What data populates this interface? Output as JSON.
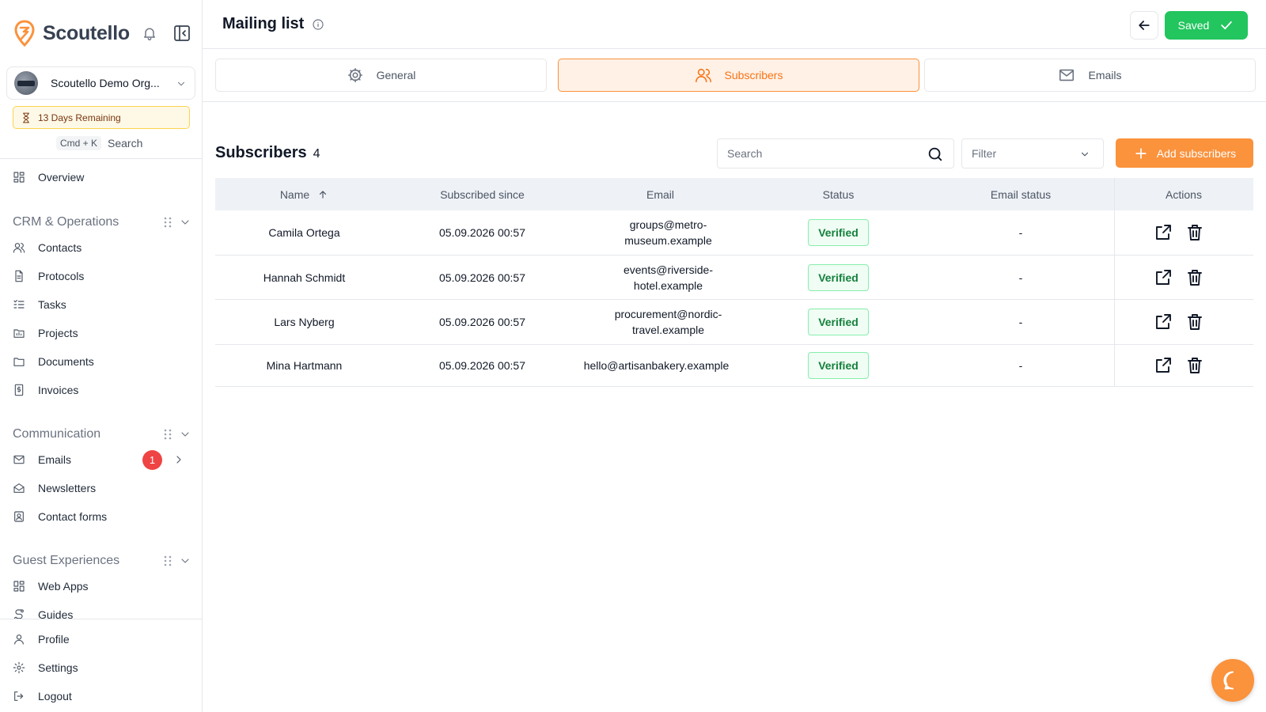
{
  "app": {
    "brand": "Scoutello",
    "accent_color": "#fb923c",
    "success_color": "#22c55e"
  },
  "sidebar": {
    "org_name": "Scoutello Demo Org...",
    "trial_text": "13 Days Remaining",
    "shortcut_key": "Cmd + K",
    "shortcut_label": "Search",
    "overview": "Overview",
    "sections": [
      {
        "title": "CRM & Operations",
        "items": [
          {
            "label": "Contacts",
            "icon": "contacts-icon"
          },
          {
            "label": "Protocols",
            "icon": "protocol-icon"
          },
          {
            "label": "Tasks",
            "icon": "tasks-icon"
          },
          {
            "label": "Projects",
            "icon": "projects-icon"
          },
          {
            "label": "Documents",
            "icon": "documents-icon"
          },
          {
            "label": "Invoices",
            "icon": "invoice-icon"
          }
        ]
      },
      {
        "title": "Communication",
        "items": [
          {
            "label": "Emails",
            "icon": "mail-icon",
            "badge": "1"
          },
          {
            "label": "Newsletters",
            "icon": "newsletter-icon"
          },
          {
            "label": "Contact forms",
            "icon": "contact-form-icon"
          }
        ]
      },
      {
        "title": "Guest Experiences",
        "items": [
          {
            "label": "Web Apps",
            "icon": "web-apps-icon"
          },
          {
            "label": "Guides",
            "icon": "guides-icon"
          }
        ]
      }
    ],
    "bottom": [
      {
        "label": "Profile",
        "icon": "profile-icon"
      },
      {
        "label": "Settings",
        "icon": "settings-icon"
      },
      {
        "label": "Logout",
        "icon": "logout-icon"
      }
    ]
  },
  "header": {
    "title": "Mailing list",
    "saved_label": "Saved"
  },
  "tabs": [
    {
      "label": "General",
      "icon": "gear-icon",
      "active": false
    },
    {
      "label": "Subscribers",
      "icon": "users-icon",
      "active": true
    },
    {
      "label": "Emails",
      "icon": "mail-icon",
      "active": false
    }
  ],
  "subscribers": {
    "title": "Subscribers",
    "count": "4",
    "search_placeholder": "Search",
    "filter_placeholder": "Filter",
    "add_label": "Add subscribers",
    "columns": [
      "Name",
      "Subscribed since",
      "Email",
      "Status",
      "Email status",
      "Actions"
    ],
    "rows": [
      {
        "name": "Camila Ortega",
        "since": "05.09.2026 00:57",
        "email": "groups@metro-museum.example",
        "status": "Verified",
        "email_status": "-"
      },
      {
        "name": "Hannah Schmidt",
        "since": "05.09.2026 00:57",
        "email": "events@riverside-hotel.example",
        "status": "Verified",
        "email_status": "-"
      },
      {
        "name": "Lars Nyberg",
        "since": "05.09.2026 00:57",
        "email": "procurement@nordic-travel.example",
        "status": "Verified",
        "email_status": "-"
      },
      {
        "name": "Mina Hartmann",
        "since": "05.09.2026 00:57",
        "email": "hello@artisanbakery.example",
        "status": "Verified",
        "email_status": "-"
      }
    ]
  }
}
